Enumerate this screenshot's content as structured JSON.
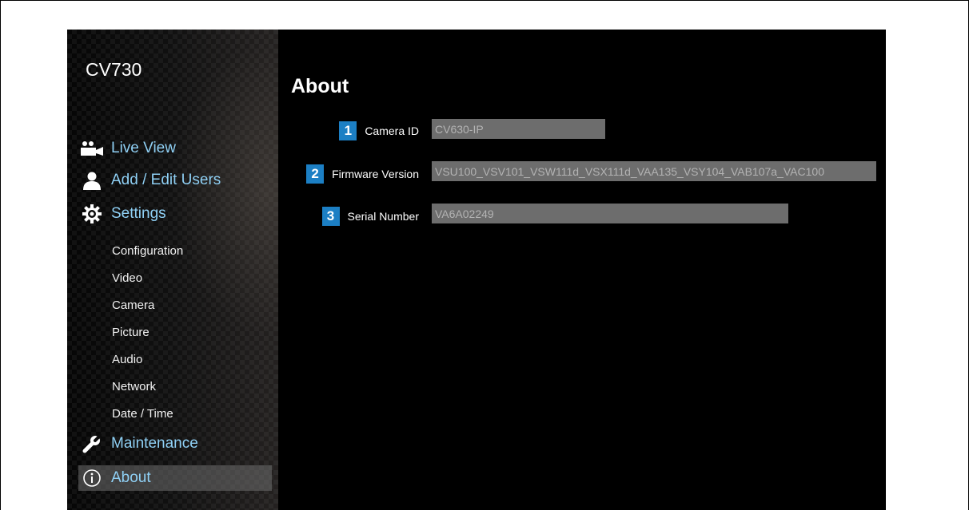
{
  "app": {
    "brand": "CV730"
  },
  "sidebar": {
    "main_items": [
      {
        "label": "Live View",
        "icon": "users-camera-icon"
      },
      {
        "label": "Add / Edit Users",
        "icon": "user-icon"
      },
      {
        "label": "Settings",
        "icon": "gear-icon"
      }
    ],
    "settings_items": [
      "Configuration",
      "Video",
      "Camera",
      "Picture",
      "Audio",
      "Network",
      "Date / Time"
    ],
    "bottom_items": [
      {
        "label": "Maintenance",
        "icon": "wrench-icon"
      },
      {
        "label": "About",
        "icon": "info-icon",
        "active": true
      }
    ]
  },
  "page": {
    "title": "About",
    "fields": [
      {
        "number": "1",
        "label": "Camera ID",
        "value": "CV630-IP"
      },
      {
        "number": "2",
        "label": "Firmware Version",
        "value": "VSU100_VSV101_VSW111d_VSX111d_VAA135_VSY104_VAB107a_VAC100"
      },
      {
        "number": "3",
        "label": "Serial Number",
        "value": "VA6A02249"
      }
    ]
  },
  "colors": {
    "accent_badge": "#1c7fc4",
    "nav_link": "#8fd0f5",
    "input_bg": "#6d6d6d"
  }
}
